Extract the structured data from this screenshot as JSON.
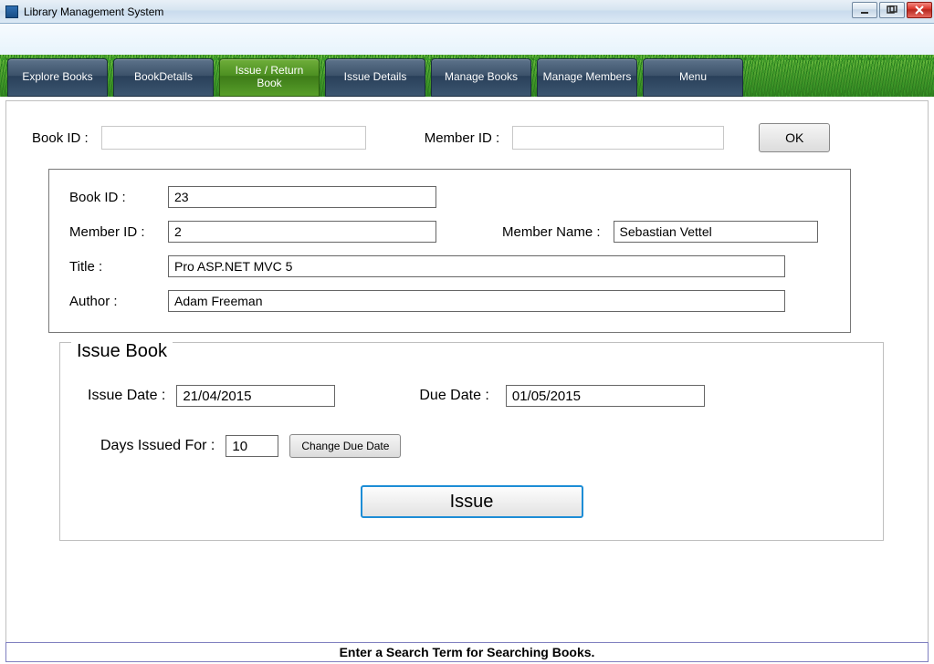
{
  "window": {
    "title": "Library Management System"
  },
  "tabs": [
    "Explore Books",
    "BookDetails",
    "Issue / Return Book",
    "Issue Details",
    "Manage Books",
    "Manage Members",
    "Menu"
  ],
  "active_tab_index": 2,
  "top": {
    "book_id_label": "Book ID :",
    "book_id_value": "",
    "member_id_label": "Member ID :",
    "member_id_value": "",
    "ok_label": "OK"
  },
  "details": {
    "book_id_label": "Book ID :",
    "book_id_value": "23",
    "member_id_label": "Member ID :",
    "member_id_value": "2",
    "member_name_label": "Member Name :",
    "member_name_value": "Sebastian Vettel",
    "title_label": "Title :",
    "title_value": "Pro ASP.NET MVC 5",
    "author_label": "Author :",
    "author_value": "Adam Freeman"
  },
  "issue": {
    "legend": "Issue Book",
    "issue_date_label": "Issue Date :",
    "issue_date_value": "21/04/2015",
    "due_date_label": "Due Date :",
    "due_date_value": "01/05/2015",
    "days_label": "Days Issued For :",
    "days_value": "10",
    "change_due_label": "Change Due Date",
    "issue_button_label": "Issue"
  },
  "status": "Enter a Search Term for Searching Books."
}
